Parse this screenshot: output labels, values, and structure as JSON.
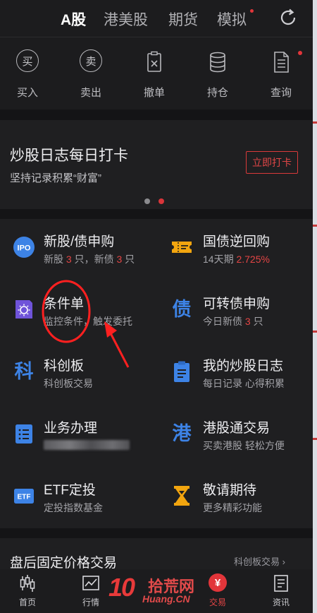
{
  "top_tabs": [
    {
      "label": "A股",
      "active": true
    },
    {
      "label": "港美股",
      "active": false
    },
    {
      "label": "期货",
      "active": false
    },
    {
      "label": "模拟",
      "active": false,
      "badge": true
    }
  ],
  "actions": {
    "buy": {
      "glyph": "买",
      "label": "买入"
    },
    "sell": {
      "glyph": "卖",
      "label": "卖出"
    },
    "cancel": {
      "label": "撤单"
    },
    "position": {
      "label": "持仓"
    },
    "query": {
      "label": "查询",
      "badge": true
    }
  },
  "banner": {
    "title": "炒股日志每日打卡",
    "subtitle": "坚持记录积累“财富”",
    "button": "立即打卡",
    "pages": 2,
    "active_page": 2
  },
  "grid": {
    "ipo": {
      "icon": "IPO",
      "title": "新股/债申购",
      "s1": "新股 ",
      "n1": "3",
      "s2": " 只，新债 ",
      "n2": "3",
      "s3": " 只"
    },
    "repo": {
      "title": "国债逆回购",
      "s1": "14天期 ",
      "rate": "2.725%"
    },
    "cond": {
      "title": "条件单",
      "sub": "监控条件，触发委托"
    },
    "bond": {
      "icon": "债",
      "title": "可转债申购",
      "s1": "今日新债 ",
      "n1": "3",
      "s2": " 只"
    },
    "star": {
      "icon": "科",
      "title": "科创板",
      "sub": "科创板交易"
    },
    "diary": {
      "title": "我的炒股日志",
      "sub": "每日记录 心得积累"
    },
    "biz": {
      "title": "业务办理"
    },
    "hk": {
      "icon": "港",
      "title": "港股通交易",
      "sub": "买卖港股 轻松方便"
    },
    "etf": {
      "icon": "ETF",
      "title": "ETF定投",
      "sub": "定投指数基金"
    },
    "soon": {
      "title": "敬请期待",
      "sub": "更多精彩功能"
    }
  },
  "after_hours": {
    "title": "盘后固定价格交易",
    "link": "科创板交易"
  },
  "nav": {
    "home": "首页",
    "market": "行情",
    "trade": {
      "glyph": "¥",
      "label": "交易"
    },
    "news": "资讯"
  },
  "watermark": {
    "big": "10",
    "text": "拾荒网",
    "url": "Huang.CN"
  },
  "colors": {
    "accent": "#e2353a",
    "blue": "#3d83e6",
    "orange": "#f2a50f",
    "bg": "#1c1c1e"
  }
}
